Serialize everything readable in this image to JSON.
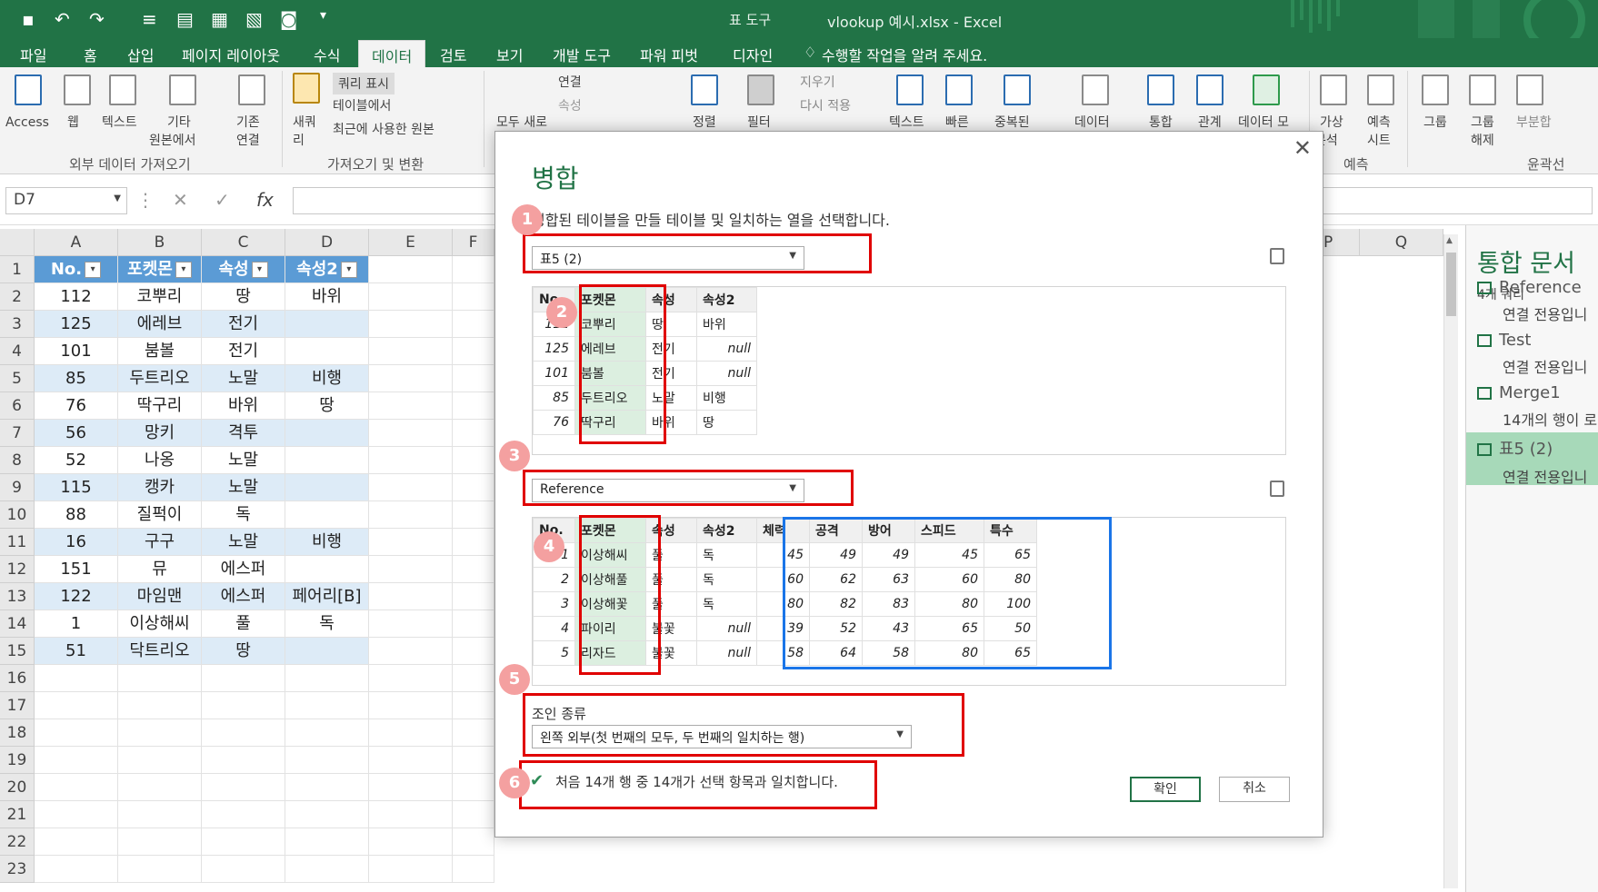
{
  "window": {
    "context_tab_label": "표 도구",
    "title": "vlookup 예시.xlsx - Excel"
  },
  "tabs": [
    "파일",
    "홈",
    "삽입",
    "페이지 레이아웃",
    "수식",
    "데이터",
    "검토",
    "보기",
    "개발 도구",
    "파워 피벗",
    "디자인"
  ],
  "tell_me": "수행할 작업을 알려 주세요.",
  "ribbon": {
    "external": {
      "access": "Access",
      "web": "웹",
      "text": "텍스트",
      "other1": "기타",
      "other2": "원본에서",
      "existing1": "기존",
      "existing2": "연결",
      "group": "외부 데이터 가져오기"
    },
    "transform": {
      "new_query1": "새쿼",
      "new_query2": "리",
      "show_queries": "쿼리 표시",
      "from_table": "테이블에서",
      "recent_sources": "최근에 사용한 원본",
      "group": "가져오기 및 변환"
    },
    "connections": {
      "refresh_all": "모두 새로",
      "connections": "연결",
      "properties": "속성"
    },
    "sort_filter": {
      "sort": "정렬",
      "filter": "필터",
      "clear": "지우기",
      "reapply": "다시 적용"
    },
    "tools": {
      "text_to_col": "텍스트",
      "flash": "빠른",
      "dup": "중복된",
      "validation": "데이터",
      "consolidate": "통합",
      "relations": "관계",
      "data_model": "데이터 모"
    },
    "forecast": {
      "whatif1": "가상",
      "whatif2": "분석",
      "sheet1": "예측",
      "sheet2": "시트",
      "group": "예측"
    },
    "outline": {
      "group_btn": "그룹",
      "ungroup1": "그룹",
      "ungroup2": "해제",
      "subtotal": "부분합",
      "group": "윤곽선"
    }
  },
  "formula_bar": {
    "name_box": "D7",
    "fx": "fx"
  },
  "sheet": {
    "columns": [
      "A",
      "B",
      "C",
      "D",
      "E",
      "F",
      "P",
      "Q"
    ],
    "header": [
      "No.",
      "포켓몬",
      "속성",
      "속성2"
    ],
    "rows": [
      [
        "112",
        "코뿌리",
        "땅",
        "바위"
      ],
      [
        "125",
        "에레브",
        "전기",
        ""
      ],
      [
        "101",
        "붐볼",
        "전기",
        ""
      ],
      [
        "85",
        "두트리오",
        "노말",
        "비행"
      ],
      [
        "76",
        "딱구리",
        "바위",
        "땅"
      ],
      [
        "56",
        "망키",
        "격투",
        ""
      ],
      [
        "52",
        "나옹",
        "노말",
        ""
      ],
      [
        "115",
        "캥카",
        "노말",
        ""
      ],
      [
        "88",
        "질퍽이",
        "독",
        ""
      ],
      [
        "16",
        "구구",
        "노말",
        "비행"
      ],
      [
        "151",
        "뮤",
        "에스퍼",
        ""
      ],
      [
        "122",
        "마임맨",
        "에스퍼",
        "페어리[B]"
      ],
      [
        "1",
        "이상해씨",
        "풀",
        "독"
      ],
      [
        "51",
        "닥트리오",
        "땅",
        ""
      ]
    ],
    "row_numbers": [
      "1",
      "2",
      "3",
      "4",
      "5",
      "6",
      "7",
      "8",
      "9",
      "10",
      "11",
      "12",
      "13",
      "14",
      "15",
      "16",
      "17",
      "18",
      "19",
      "20",
      "21",
      "22",
      "23"
    ]
  },
  "pane": {
    "title": "통합 문서",
    "count": "4개 쿼리",
    "queries": [
      {
        "name": "Reference",
        "sub": "연결 전용입니"
      },
      {
        "name": "Test",
        "sub": "연결 전용입니"
      },
      {
        "name": "Merge1",
        "sub": "14개의 행이 로"
      },
      {
        "name": "표5 (2)",
        "sub": "연결 전용입니"
      }
    ]
  },
  "dialog": {
    "title": "병합",
    "description": "병합된 테이블을 만들 테이블 및 일치하는 열을 선택합니다.",
    "table1_select": "표5 (2)",
    "table1": {
      "headers": [
        "No.",
        "포켓몬",
        "속성",
        "속성2"
      ],
      "rows": [
        [
          "112",
          "코뿌리",
          "땅",
          "바위"
        ],
        [
          "125",
          "에레브",
          "전기",
          "null"
        ],
        [
          "101",
          "붐볼",
          "전기",
          "null"
        ],
        [
          "85",
          "두트리오",
          "노말",
          "비행"
        ],
        [
          "76",
          "딱구리",
          "바위",
          "땅"
        ]
      ]
    },
    "table2_select": "Reference",
    "table2": {
      "headers": [
        "No.",
        "포켓몬",
        "속성",
        "속성2",
        "체력",
        "공격",
        "방어",
        "스피드",
        "특수"
      ],
      "rows": [
        [
          "1",
          "이상해씨",
          "풀",
          "독",
          "45",
          "49",
          "49",
          "45",
          "65"
        ],
        [
          "2",
          "이상해풀",
          "풀",
          "독",
          "60",
          "62",
          "63",
          "60",
          "80"
        ],
        [
          "3",
          "이상해꽃",
          "풀",
          "독",
          "80",
          "82",
          "83",
          "80",
          "100"
        ],
        [
          "4",
          "파이리",
          "불꽃",
          "null",
          "39",
          "52",
          "43",
          "65",
          "50"
        ],
        [
          "5",
          "리자드",
          "불꽃",
          "null",
          "58",
          "64",
          "58",
          "80",
          "65"
        ]
      ]
    },
    "join_label": "조인 종류",
    "join_value": "왼쪽 외부(첫 번째의 모두, 두 번째의 일치하는 행)",
    "status": "처음 14개 행 중 14개가 선택 항목과 일치합니다.",
    "ok": "확인",
    "cancel": "취소",
    "badges": [
      "1",
      "2",
      "3",
      "4",
      "5",
      "6"
    ]
  },
  "colors": {
    "excel_green": "#217346",
    "table_header": "#5b9bd5",
    "band": "#ddebf7",
    "highlight_red": "#e00000",
    "highlight_blue": "#1a75e8"
  }
}
